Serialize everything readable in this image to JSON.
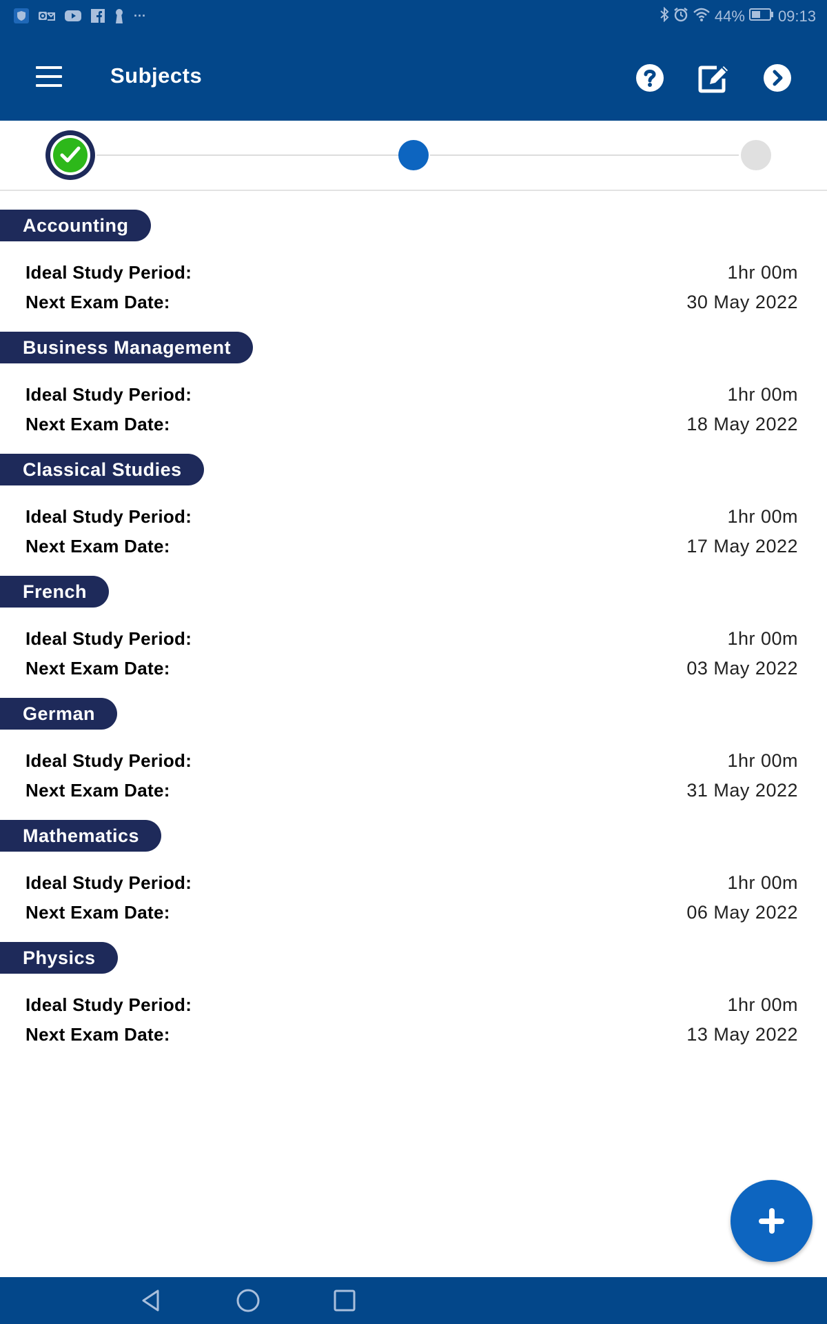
{
  "status_bar": {
    "left_icons": [
      "shield-icon",
      "outlook-icon",
      "youtube-icon",
      "facebook-icon",
      "keyhole-icon",
      "more-notifications-icon"
    ],
    "more_label": "···",
    "right_icons": [
      "bluetooth-icon",
      "alarm-icon",
      "wifi-icon"
    ],
    "battery_percent": "44%",
    "time": "09:13"
  },
  "app_bar": {
    "title": "Subjects",
    "actions": [
      "help-icon",
      "edit-icon",
      "next-icon"
    ]
  },
  "stepper": {
    "steps": [
      {
        "state": "completed"
      },
      {
        "state": "current"
      },
      {
        "state": "upcoming"
      }
    ],
    "colors": {
      "completed_ring": "#1e2a5a",
      "completed_fill": "#2db81a",
      "current": "#0d65c0",
      "upcoming": "#e0e0e0"
    }
  },
  "labels": {
    "study_period": "Ideal Study Period:",
    "exam_date": "Next Exam Date:"
  },
  "subjects": [
    {
      "name": "Accounting",
      "study_period": "1hr 00m",
      "exam_date": "30 May 2022"
    },
    {
      "name": "Business Management",
      "study_period": "1hr 00m",
      "exam_date": "18 May 2022"
    },
    {
      "name": "Classical Studies",
      "study_period": "1hr 00m",
      "exam_date": "17 May 2022"
    },
    {
      "name": "French",
      "study_period": "1hr 00m",
      "exam_date": "03 May 2022"
    },
    {
      "name": "German",
      "study_period": "1hr 00m",
      "exam_date": "31 May 2022"
    },
    {
      "name": "Mathematics",
      "study_period": "1hr 00m",
      "exam_date": "06 May 2022"
    },
    {
      "name": "Physics",
      "study_period": "1hr 00m",
      "exam_date": "13 May 2022"
    }
  ],
  "fab": {
    "icon": "plus-icon"
  },
  "nav_bar": {
    "buttons": [
      "back-icon",
      "home-icon",
      "recents-icon"
    ]
  },
  "colors": {
    "primary": "#03478a",
    "chip": "#1e2a5a",
    "accent": "#0d65c0"
  }
}
